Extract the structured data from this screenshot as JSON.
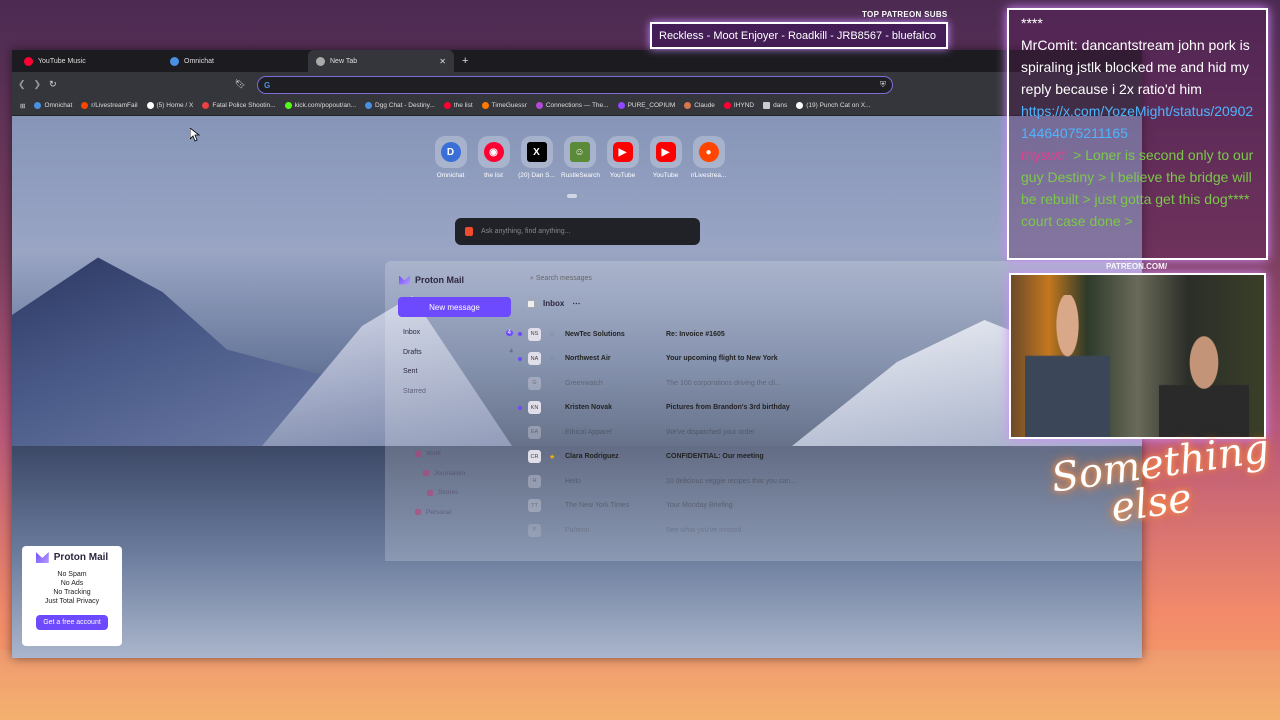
{
  "browser": {
    "tabs": [
      {
        "label": "YouTube Music",
        "color": "#ff0033"
      },
      {
        "label": "Omnichat",
        "color": "#4a90e2"
      },
      {
        "label": "New Tab",
        "color": "#aaaaaa"
      }
    ],
    "url_value": "",
    "bookmarks": [
      {
        "label": "Omnichat",
        "color": "#4a90e2"
      },
      {
        "label": "r/LivestreamFail",
        "color": "#ff4500"
      },
      {
        "label": "(5) Home / X",
        "color": "#ffffff"
      },
      {
        "label": "Fatal Police Shootin...",
        "color": "#e94040"
      },
      {
        "label": "kick.com/popout/an...",
        "color": "#53fc18"
      },
      {
        "label": "Dgg Chat - Destiny...",
        "color": "#4a90e2"
      },
      {
        "label": "the list",
        "color": "#ff0033"
      },
      {
        "label": "TimeGuessr",
        "color": "#ff7a00"
      },
      {
        "label": "Connections — The...",
        "color": "#b04ad8"
      },
      {
        "label": "PURE_COPIUM",
        "color": "#9146ff"
      },
      {
        "label": "Claude",
        "color": "#d9774a"
      },
      {
        "label": "IHYND",
        "color": "#ff0033"
      },
      {
        "label": "dans",
        "color": "#cccccc"
      },
      {
        "label": "(19) Punch Cat on X...",
        "color": "#ffffff"
      }
    ]
  },
  "newtab": {
    "shortcuts": [
      {
        "label": "Omnichat",
        "glyph": "D",
        "color": "#3a6fd8"
      },
      {
        "label": "the list",
        "glyph": "◉",
        "color": "#ff0033"
      },
      {
        "label": "(20) Dan S...",
        "glyph": "X",
        "color": "#000000"
      },
      {
        "label": "RustleSearch",
        "glyph": "🐸",
        "color": "#5a8a3a"
      },
      {
        "label": "YouTube",
        "glyph": "▶",
        "color": "#ff0000"
      },
      {
        "label": "YouTube",
        "glyph": "▶",
        "color": "#ff0000"
      },
      {
        "label": "r/Livestrea...",
        "glyph": "●",
        "color": "#ff4500"
      }
    ],
    "ask_placeholder": "Ask anything, find anything..."
  },
  "protonmail": {
    "brand": "Proton Mail",
    "search_placeholder": "Search messages",
    "new_message": "New message",
    "folders": [
      {
        "label": "Inbox",
        "count": "4"
      },
      {
        "label": "Drafts",
        "count": "4"
      },
      {
        "label": "Sent",
        "count": ""
      },
      {
        "label": "Starred",
        "count": ""
      }
    ],
    "labels": [
      "Work",
      "Journalism",
      "Stories",
      "Personal"
    ],
    "inbox_title": "Inbox",
    "mails": [
      {
        "avatar": "NS",
        "from": "NewTec Solutions",
        "subject": "Re: Invoice #1605",
        "unread": true,
        "starred": false
      },
      {
        "avatar": "NA",
        "from": "Northwest Air",
        "subject": "Your upcoming flight to New York",
        "unread": true,
        "starred": false
      },
      {
        "avatar": "G",
        "from": "Greenwatch",
        "subject": "The 100 corporations driving the cli...",
        "unread": false,
        "starred": false
      },
      {
        "avatar": "KN",
        "from": "Kristen Novak",
        "subject": "Pictures from Brandon's 3rd birthday",
        "unread": true,
        "starred": false
      },
      {
        "avatar": "EA",
        "from": "Ethical Apparel",
        "subject": "We've dispatched your order",
        "unread": false,
        "starred": false
      },
      {
        "avatar": "CR",
        "from": "Clara Rodriguez",
        "subject": "CONFIDENTIAL: Our meeting",
        "unread": false,
        "starred": true
      },
      {
        "avatar": "H",
        "from": "Hello",
        "subject": "10 delicious veggie recipes that you can...",
        "unread": false,
        "starred": false
      },
      {
        "avatar": "TT",
        "from": "The New York Times",
        "subject": "Your Monday Briefing",
        "unread": false,
        "starred": false
      },
      {
        "avatar": "P",
        "from": "Patreon",
        "subject": "See what you've missed",
        "unread": false,
        "starred": false
      }
    ]
  },
  "ad": {
    "brand": "Proton Mail",
    "lines": [
      "No Spam",
      "No Ads",
      "No Tracking",
      "Just Total Privacy"
    ],
    "cta": "Get a free account"
  },
  "overlay": {
    "patreon_label": "TOP PATREON SUBS",
    "patreon_names": "Reckless - Moot Enjoyer - Roadkill - JRB8567 - bluefalco",
    "chat_top": "****",
    "chat_msg1": "MrComit: dancantstream john pork is spiraling jstlk blocked me and hid my reply because i 2x ratio'd him",
    "chat_link": "https://x.com/YozeMight/status/2090214464075211165",
    "chat_user2": "rhyswtf:",
    "chat_msg2": "> Loner is second only to our guy Destiny > I believe the bridge will be rebuilt > just gotta get this dog**** court case done >",
    "patreon_url": "PATREON.COM/",
    "signature_line1": "Something",
    "signature_line2": "else"
  },
  "colors": {
    "accent": "#6d4aff",
    "url_border": "#7c6dd8"
  }
}
